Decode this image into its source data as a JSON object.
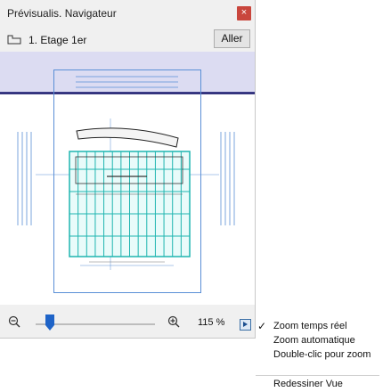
{
  "window": {
    "title": "Prévisualis. Navigateur",
    "close_glyph": "×"
  },
  "story": {
    "label": "1. Etage 1er",
    "go_label": "Aller"
  },
  "zoom": {
    "value_text": "115 %",
    "slider_level": 0.12
  },
  "menu": {
    "items": [
      {
        "label": "Zoom temps réel",
        "checked": true
      },
      {
        "label": "Zoom automatique",
        "checked": false
      },
      {
        "label": "Double-clic pour zoom",
        "checked": false
      },
      {
        "label": "Redessiner Vue",
        "checked": false
      }
    ],
    "check_glyph": "✓"
  },
  "colors": {
    "accent_band": "#dcdcf2",
    "dark_line": "#1a1a6e",
    "plan_blue": "#5a8fd6",
    "plan_cyan": "#1fb5b0",
    "close_red": "#c9463d",
    "slider_thumb": "#1f64c8"
  },
  "icons": {
    "close": "close-icon",
    "story": "story-level-icon",
    "zoom_out": "zoom-out-icon",
    "zoom_in": "zoom-in-icon",
    "menu": "menu-arrow-icon",
    "check": "checkmark-icon"
  }
}
